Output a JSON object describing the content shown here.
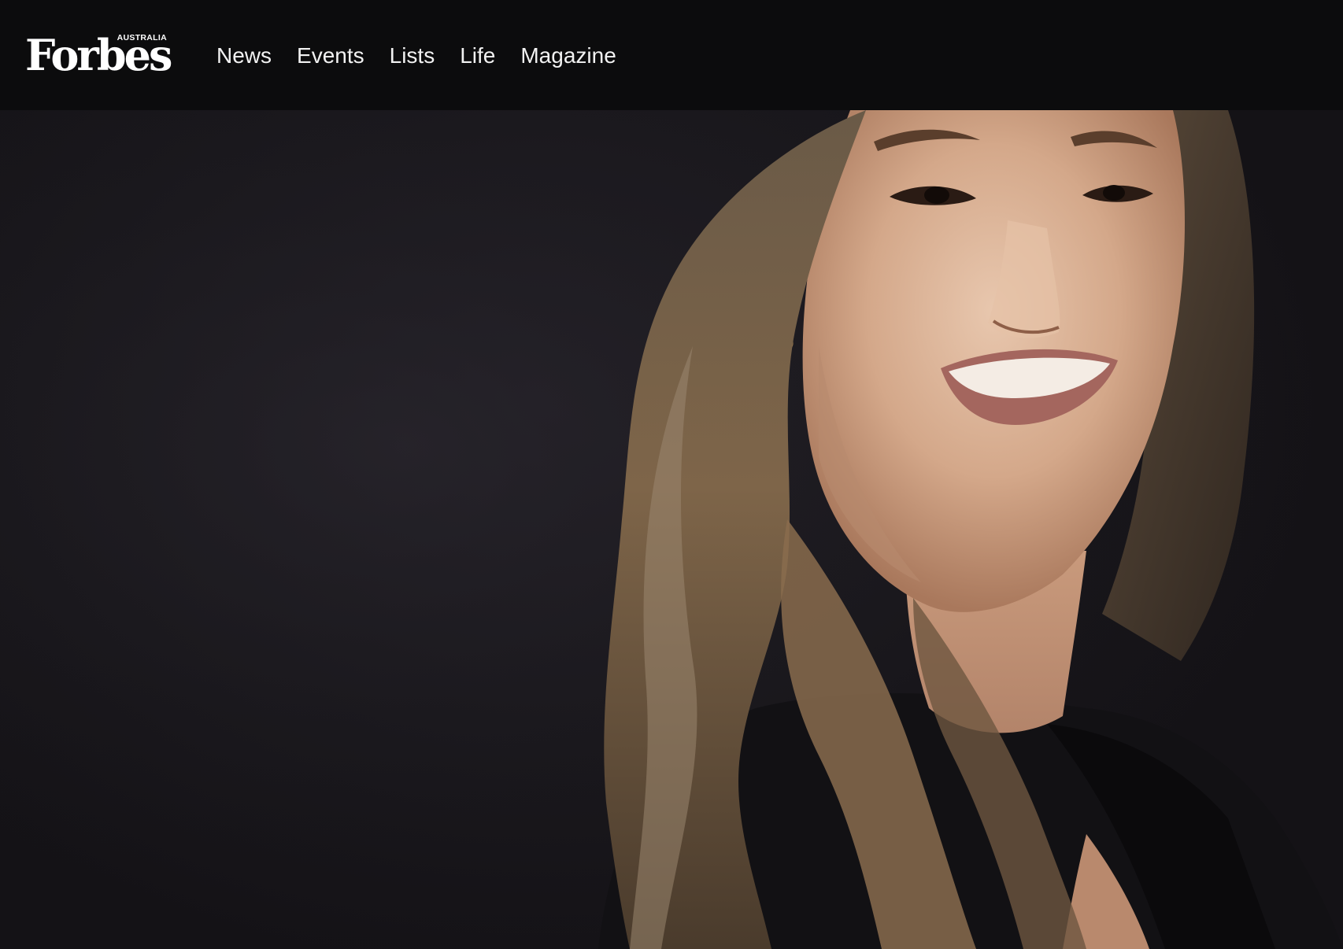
{
  "header": {
    "logo_text": "Forbes",
    "logo_sub": "AUSTRALIA",
    "nav": [
      {
        "label": "News"
      },
      {
        "label": "Events"
      },
      {
        "label": "Lists"
      },
      {
        "label": "Life"
      },
      {
        "label": "Magazine"
      }
    ]
  },
  "colors": {
    "header_bg": "#0c0c0d",
    "nav_text": "#f2f2f2",
    "hero_bg": "#1a181d"
  }
}
